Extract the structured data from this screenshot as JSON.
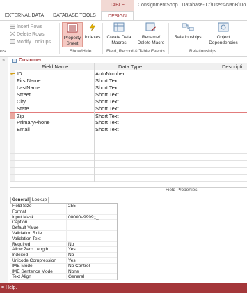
{
  "title_bar": {
    "context_group": "TABLE TOOLS",
    "window_title": "ConsignmentShop : Database- C:\\Users\\NanB\\Do"
  },
  "tabs": {
    "external_data": "EXTERNAL DATA",
    "database_tools": "DATABASE TOOLS",
    "design": "DESIGN"
  },
  "ribbon": {
    "tools_group": {
      "insert_rows": "Insert Rows",
      "delete_rows": "Delete Rows",
      "modify_lookups": "Modify Lookups",
      "label": "ols"
    },
    "show_hide": {
      "property_sheet": "Property Sheet",
      "indexes": "Indexes",
      "label": "Show/Hide"
    },
    "events": {
      "create_data_macros": "Create Data Macros",
      "rename_delete_macro": "Rename/ Delete Macro",
      "label": "Field, Record & Table Events"
    },
    "relationships_group": {
      "relationships": "Relationships",
      "object_dependencies": "Object Dependencies",
      "label": "Relationships"
    }
  },
  "document_tab": {
    "label": "Customer"
  },
  "design_grid": {
    "headers": [
      "Field Name",
      "Data Type",
      "Descripti"
    ],
    "rows": [
      {
        "field": "ID",
        "type": "AutoNumber",
        "key": true
      },
      {
        "field": "FirstName",
        "type": "Short Text"
      },
      {
        "field": "LastName",
        "type": "Short Text"
      },
      {
        "field": "Street",
        "type": "Short Text"
      },
      {
        "field": "City",
        "type": "Short Text"
      },
      {
        "field": "State",
        "type": "Short Text"
      },
      {
        "field": "Zip",
        "type": "Short Text",
        "selected": true
      },
      {
        "field": "PrimaryPhone",
        "type": "Short Text"
      },
      {
        "field": "Email",
        "type": "Short Text"
      }
    ]
  },
  "properties": {
    "section_label": "Field Properties",
    "tabs": [
      "General",
      "Lookup"
    ],
    "rows": [
      {
        "label": "Field Size",
        "value": "255"
      },
      {
        "label": "Format",
        "value": ""
      },
      {
        "label": "Input Mask",
        "value": "00000\\-9999;;_"
      },
      {
        "label": "Caption",
        "value": ""
      },
      {
        "label": "Default Value",
        "value": ""
      },
      {
        "label": "Validation Rule",
        "value": ""
      },
      {
        "label": "Validation Text",
        "value": ""
      },
      {
        "label": "Required",
        "value": "No"
      },
      {
        "label": "Allow Zero Length",
        "value": "Yes"
      },
      {
        "label": "Indexed",
        "value": "No"
      },
      {
        "label": "Unicode Compression",
        "value": "Yes"
      },
      {
        "label": "IME Mode",
        "value": "No Control"
      },
      {
        "label": "IME Sentence Mode",
        "value": "None"
      },
      {
        "label": "Text Align",
        "value": "General"
      }
    ]
  },
  "status_bar": {
    "text": "= Help."
  },
  "colors": {
    "accent": "#a4373a",
    "context_tab_bg": "#f2d9d4",
    "selected_button_bg": "#f5c9c3"
  }
}
